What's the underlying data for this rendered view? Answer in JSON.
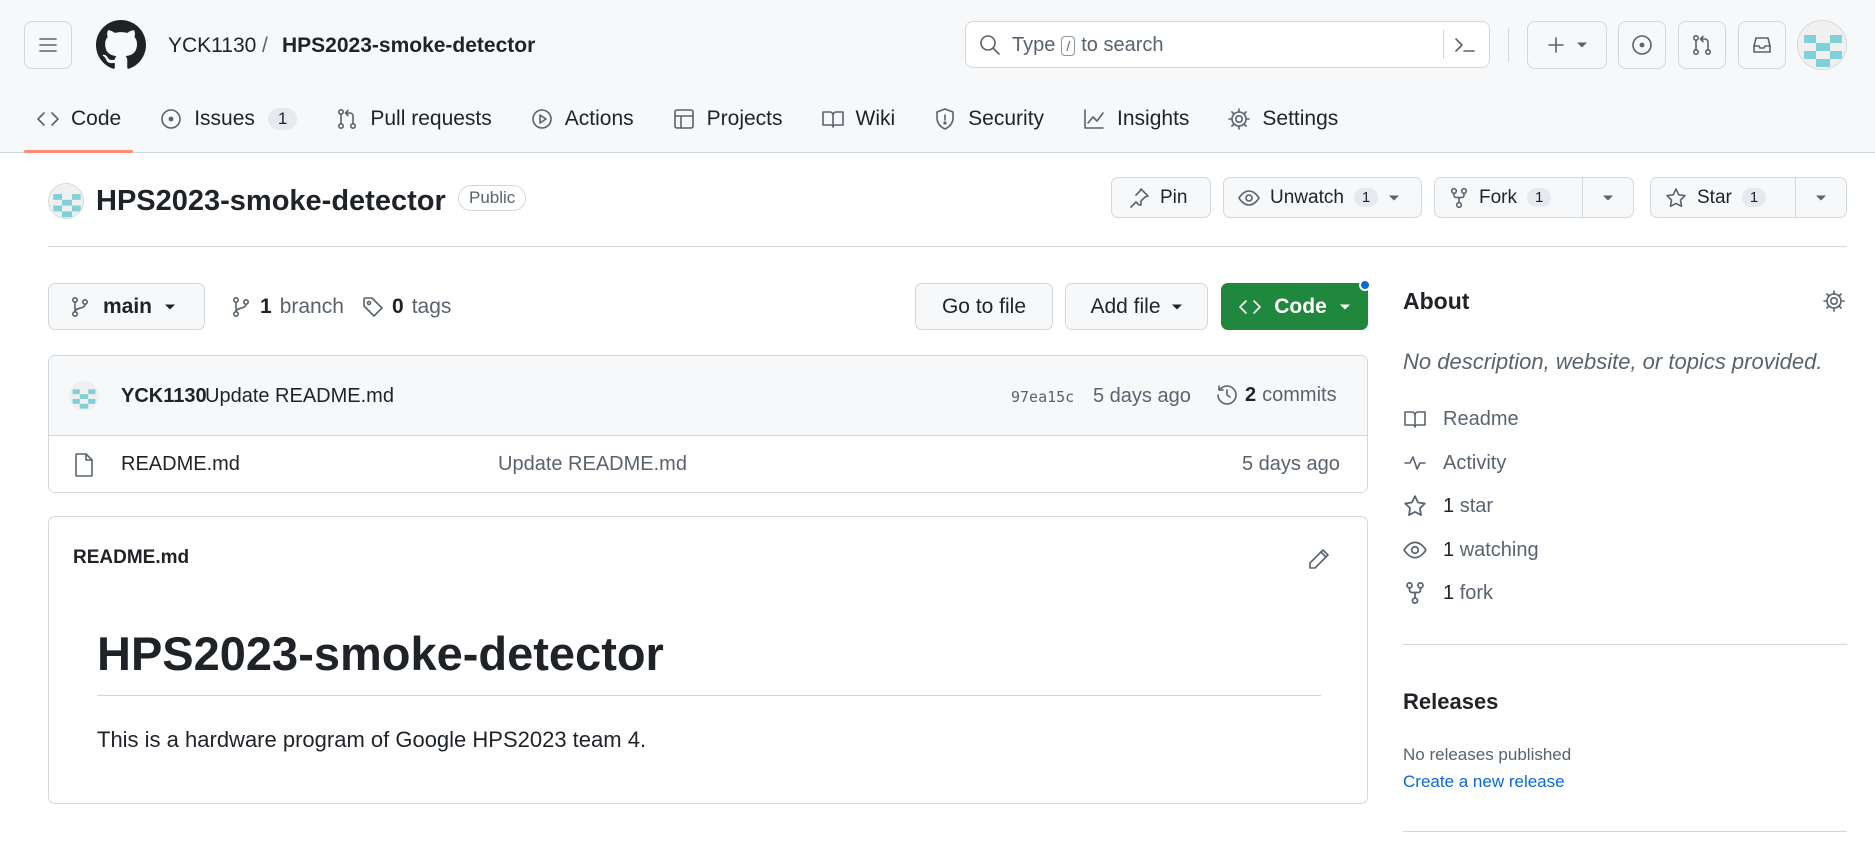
{
  "header": {
    "owner": "YCK1130",
    "separator": "/",
    "repo": "HPS2023-smoke-detector",
    "search": {
      "prefix": "Type",
      "key": "/",
      "suffix": "to search"
    }
  },
  "tabs": [
    {
      "label": "Code",
      "icon": "code-icon"
    },
    {
      "label": "Issues",
      "icon": "issue-icon",
      "count": "1"
    },
    {
      "label": "Pull requests",
      "icon": "pull-request-icon"
    },
    {
      "label": "Actions",
      "icon": "play-icon"
    },
    {
      "label": "Projects",
      "icon": "table-icon"
    },
    {
      "label": "Wiki",
      "icon": "book-icon"
    },
    {
      "label": "Security",
      "icon": "shield-icon"
    },
    {
      "label": "Insights",
      "icon": "graph-icon"
    },
    {
      "label": "Settings",
      "icon": "gear-icon"
    }
  ],
  "repo_header": {
    "title": "HPS2023-smoke-detector",
    "visibility": "Public",
    "pin": "Pin",
    "watch": {
      "label": "Unwatch",
      "count": "1"
    },
    "fork": {
      "label": "Fork",
      "count": "1"
    },
    "star": {
      "label": "Star",
      "count": "1"
    }
  },
  "branch_bar": {
    "branch": "main",
    "branch_count": "1",
    "branch_label": "branch",
    "tag_count": "0",
    "tag_label": "tags",
    "go_to_file": "Go to file",
    "add_file": "Add file",
    "code": "Code"
  },
  "latest_commit": {
    "author": "YCK1130",
    "message": "Update README.md",
    "sha": "97ea15c",
    "time": "5 days ago",
    "count": "2",
    "count_label": "commits"
  },
  "files": [
    {
      "name": "README.md",
      "message": "Update README.md",
      "time": "5 days ago"
    }
  ],
  "readme": {
    "filename": "README.md",
    "heading": "HPS2023-smoke-detector",
    "body": "This is a hardware program of Google HPS2023 team 4."
  },
  "about": {
    "title": "About",
    "description": "No description, website, or topics provided.",
    "links": {
      "readme": {
        "label": "Readme"
      },
      "activity": {
        "label": "Activity"
      },
      "stars": {
        "count": "1",
        "label": "star"
      },
      "watching": {
        "count": "1",
        "label": "watching"
      },
      "forks": {
        "count": "1",
        "label": "fork"
      }
    }
  },
  "releases": {
    "title": "Releases",
    "none": "No releases published",
    "create": "Create a new release"
  },
  "colors": {
    "primary_button": "#1f883d",
    "link": "#0969da",
    "active_tab_underline": "#fd8c73",
    "notification_dot": "#0969da"
  }
}
